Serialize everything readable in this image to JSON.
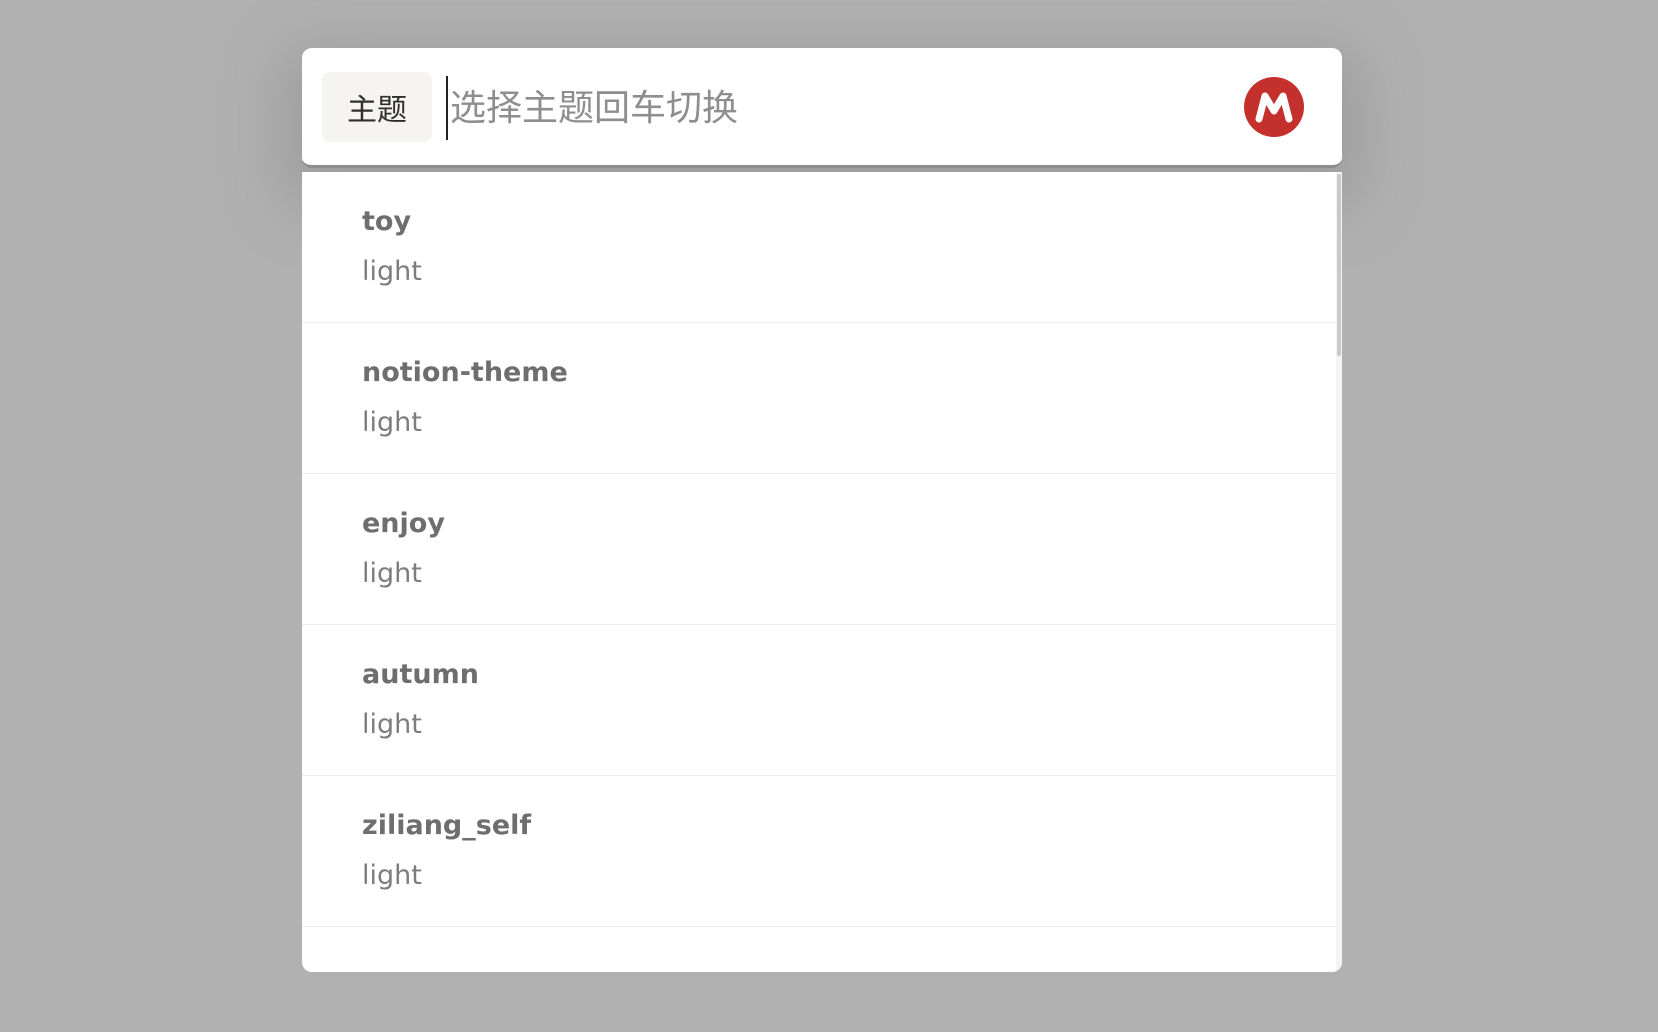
{
  "search": {
    "tag_label": "主题",
    "value": "",
    "placeholder": "选择主题回车切换"
  },
  "logo": {
    "icon": "m-logo-icon",
    "color": "#c4302b"
  },
  "results": [
    {
      "name": "toy",
      "mode": "light"
    },
    {
      "name": "notion-theme",
      "mode": "light"
    },
    {
      "name": "enjoy",
      "mode": "light"
    },
    {
      "name": "autumn",
      "mode": "light"
    },
    {
      "name": "ziliang_self",
      "mode": "light"
    }
  ]
}
